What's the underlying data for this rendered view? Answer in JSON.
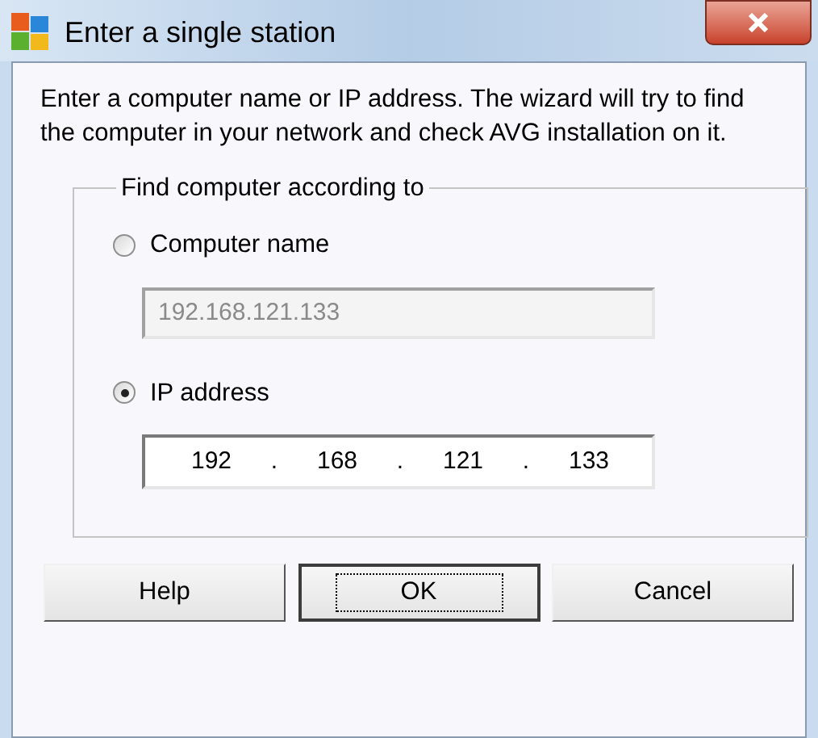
{
  "window": {
    "title": "Enter a single station"
  },
  "description": "Enter a computer name or IP address. The wizard will try to find the computer in your network and check AVG installation on it.",
  "group": {
    "label": "Find computer according to",
    "options": [
      {
        "label": "Computer name",
        "selected": false,
        "field": {
          "kind": "text",
          "value": "192.168.121.133",
          "disabled": true
        }
      },
      {
        "label": "IP address",
        "selected": true,
        "field": {
          "kind": "ip",
          "octets": [
            "192",
            "168",
            "121",
            "133"
          ],
          "separators": [
            ".",
            ".",
            "."
          ],
          "disabled": false
        }
      }
    ]
  },
  "buttons": [
    {
      "label": "Help",
      "default": false
    },
    {
      "label": "OK",
      "default": true
    },
    {
      "label": "Cancel",
      "default": false
    }
  ]
}
